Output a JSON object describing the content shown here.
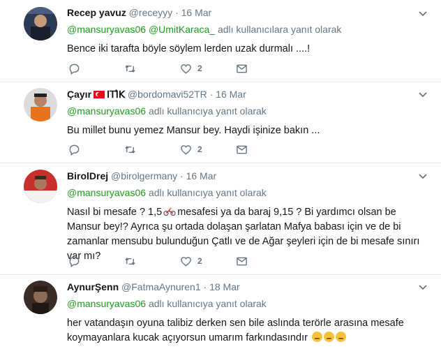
{
  "tweets": [
    {
      "name": "Recep yavuz",
      "handle": "@receyyy",
      "date": "· 16 Mar",
      "reply_mentions": [
        "@mansuryavas06",
        "@UmitKaraca_"
      ],
      "reply_suffix": "adlı kullanıcılara yanıt olarak",
      "text": "Bence iki tarafta böyle söylem lerden uzak durmalı ....!",
      "likes": "2"
    },
    {
      "name": "Çayır",
      "name_extra": "ꓲꓔꓲ҆ꓗ",
      "handle": "@bordomavi52TR",
      "date": "· 16 Mar",
      "reply_mentions": [
        "@mansuryavas06"
      ],
      "reply_suffix": "adlı kullanıcıya yanıt olarak",
      "text": "Bu millet bunu yemez Mansur bey. Haydi işinize bakın ...",
      "likes": "2"
    },
    {
      "name": "BirolDrej",
      "handle": "@birolgermany",
      "date": "· 16 Mar",
      "reply_mentions": [
        "@mansuryavas06"
      ],
      "reply_suffix": "adlı kullanıcıya yanıt olarak",
      "text_part1": "Nasıl bi mesafe ? 1,5",
      "text_part2": "mesafesi ya da baraj 9,15 ? Bi yardımcı olsan be Mansur bey!? Ayrıca şu ortada dolaşan şarlatan Mafya babası için ve de bi zamanlar mensubu bulunduğun Çatlı ve de Ağar şeyleri için de bi mesafe sınırı var mı?",
      "likes": "2"
    },
    {
      "name": "AynurŞenn",
      "handle": "@FatmaAynuren1",
      "date": "· 18 Mar",
      "reply_mentions": [
        "@mansuryavas06"
      ],
      "reply_suffix": "adlı kullanıcıya yanıt olarak",
      "text": "her vatandaşın oyuna talibiz derken sen bile aslında terörle arasına mesafe koymayanlara kucak açıyorsun umarım farkındasındır"
    }
  ],
  "colors": {
    "accent": "#1b95e0",
    "mention": "#1a9f1a",
    "muted": "#657786",
    "text": "#14171a",
    "border": "#e6ecf0"
  },
  "icons": [
    "reply-icon",
    "retweet-icon",
    "like-icon",
    "dm-icon",
    "chevron-down-icon"
  ]
}
